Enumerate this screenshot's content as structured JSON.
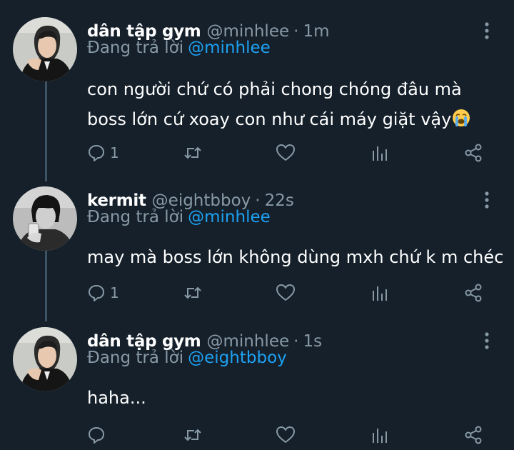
{
  "thread": {
    "tweets": [
      {
        "display_name": "dân tập gym",
        "handle": "@minhlee",
        "separator": "·",
        "time": "1m",
        "reply_prefix": "Đang trả lời",
        "reply_to": "@minhlee",
        "text_line1": "con người chứ có phải chong chóng đâu mà",
        "text_line2": "boss lớn cứ xoay con như cái máy giặt vậy",
        "emoji_icon": "crying-face-emoji-icon",
        "reply_count": "1",
        "retweet_count": "",
        "like_count": "",
        "avatar_icon": "user-avatar-icon"
      },
      {
        "display_name": "kermit",
        "handle": "@eightbboy",
        "separator": "·",
        "time": "22s",
        "reply_prefix": "Đang trả lời",
        "reply_to": "@minhlee",
        "text_line1": "may mà boss lớn không dùng mxh chứ k m chéc",
        "reply_count": "1",
        "retweet_count": "",
        "like_count": "",
        "avatar_icon": "user-avatar-icon"
      },
      {
        "display_name": "dân tập gym",
        "handle": "@minhlee",
        "separator": "·",
        "time": "1s",
        "reply_prefix": "Đang trả lời",
        "reply_to": "@eightbboy",
        "text_line1": "haha...",
        "reply_count": "",
        "retweet_count": "",
        "like_count": "",
        "avatar_icon": "user-avatar-icon"
      }
    ]
  },
  "colors": {
    "background": "#15202b",
    "secondary_text": "#8899a6",
    "link": "#1da1f2",
    "thread_line": "#3d5466"
  },
  "icons": {
    "more": "more-vertical-icon",
    "reply": "reply-icon",
    "retweet": "retweet-icon",
    "like": "like-heart-icon",
    "stats": "stats-icon",
    "share": "share-icon"
  }
}
